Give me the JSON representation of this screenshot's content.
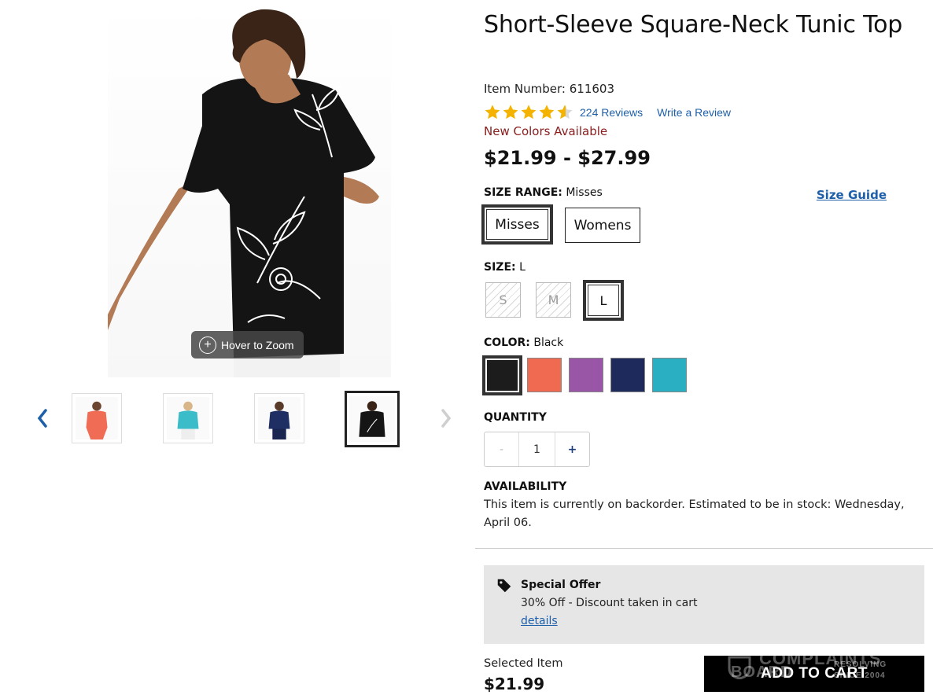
{
  "gallery": {
    "zoom_label": "Hover to Zoom",
    "prev_icon": "chevron-left-icon",
    "next_icon": "chevron-right-icon",
    "thumbnails": [
      {
        "color": "#f06c55"
      },
      {
        "color": "#3bbcc9"
      },
      {
        "color": "#1f2f63"
      },
      {
        "color": "#151515",
        "active": true
      }
    ]
  },
  "product": {
    "title": "Short-Sleeve Square-Neck Tunic Top",
    "item_number": "Item Number: 611603",
    "rating": 4.5,
    "reviews": "224 Reviews",
    "write_review": "Write a Review",
    "new_colors": "New Colors Available",
    "price_range": "$21.99 - $27.99"
  },
  "size_range": {
    "label": "SIZE RANGE:",
    "value": "Misses",
    "size_guide": "Size Guide",
    "options": [
      "Misses",
      "Womens"
    ]
  },
  "size": {
    "label": "SIZE:",
    "value": "L",
    "options": [
      "S",
      "M",
      "L"
    ]
  },
  "color": {
    "label": "COLOR:",
    "value": "Black",
    "swatches": [
      "#1c1c1c",
      "#f06a52",
      "#9a56a6",
      "#1f2a5c",
      "#29aec2"
    ]
  },
  "quantity": {
    "label": "QUANTITY",
    "value": "1",
    "dec": "-",
    "inc": "+"
  },
  "availability": {
    "label": "AVAILABILITY",
    "text": "This item is currently on backorder. Estimated to be in stock: Wednesday, April 06."
  },
  "offer": {
    "title": "Special Offer",
    "text": "30% Off - Discount taken in cart",
    "link": "details"
  },
  "selected": {
    "label": "Selected Item",
    "price": "$21.99"
  },
  "cart": {
    "button": "ADD TO CART"
  },
  "watermark": {
    "line1": "COMPLAINTS",
    "line2": "BOARD",
    "tag1": "RESOLVING",
    "tag2": "SINCE 2004"
  }
}
